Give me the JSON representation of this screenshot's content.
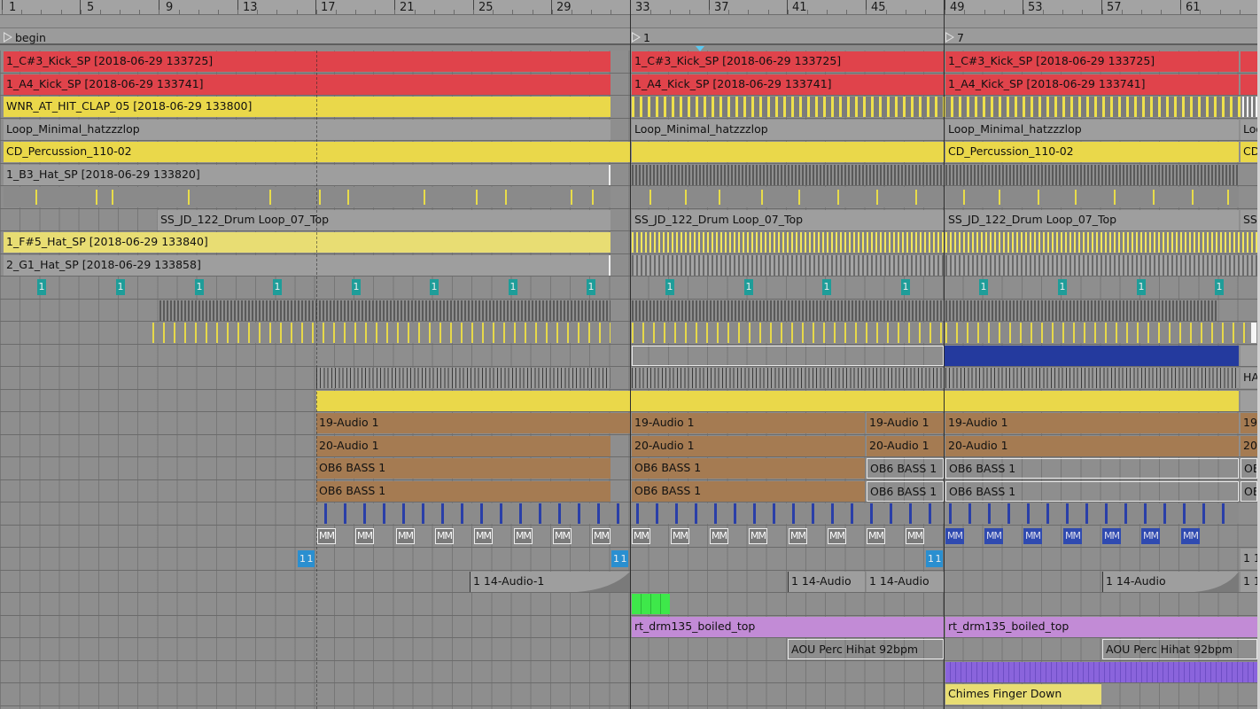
{
  "ruler": {
    "bars": [
      "1",
      "5",
      "9",
      "13",
      "17",
      "21",
      "25",
      "29",
      "33",
      "37",
      "41",
      "45",
      "49",
      "53",
      "57",
      "61"
    ]
  },
  "locators": [
    {
      "label": "begin"
    },
    {
      "label": "1"
    },
    {
      "label": "7"
    }
  ],
  "clip_labels": {
    "kick_c3": "1_C#3_Kick_SP [2018-06-29 133725]",
    "kick_a4": "1_A4_Kick_SP [2018-06-29 133741]",
    "clap": "WNR_AT_HIT_CLAP_05 [2018-06-29 133800]",
    "loop_min": "Loop_Minimal_hatzzzlop",
    "loop_min_short": "Loo",
    "perc": "CD_Percussion_110-02",
    "perc_short": "CD",
    "hat_b3": "1_B3_Hat_SP [2018-06-29 133820]",
    "drumloop": "SS_JD_122_Drum Loop_07_Top",
    "drumloop_short": "SS",
    "hat_f5": "1_F#5_Hat_SP [2018-06-29 133840]",
    "hat_g1": "2_G1_Hat_SP [2018-06-29 133858]",
    "one": "1",
    "ha_short": "HA",
    "audio19": "19-Audio 1",
    "audio19_short": "19",
    "audio20": "20-Audio 1",
    "audio20_short": "20",
    "bass": "OB6 BASS 1",
    "bass_short": "OB",
    "mm": "MM",
    "oneone": "1 1",
    "audio14_a": "1 14-Audio-1",
    "audio14_b": "1 14-Audio",
    "boiled": "rt_drm135_boiled_top",
    "aou": "AOU Perc Hihat 92bpm",
    "chimes": "Chimes Finger Down"
  },
  "colors": {
    "red": "#e0434b",
    "yellow": "#ead84a",
    "grey": "#9e9e9e",
    "brown": "#a57b52",
    "purple": "#c28bd6",
    "green": "#3ee84a",
    "navy": "#243a9e",
    "teal": "#1e9d99",
    "playhead_marker": "#5bc8f0"
  }
}
